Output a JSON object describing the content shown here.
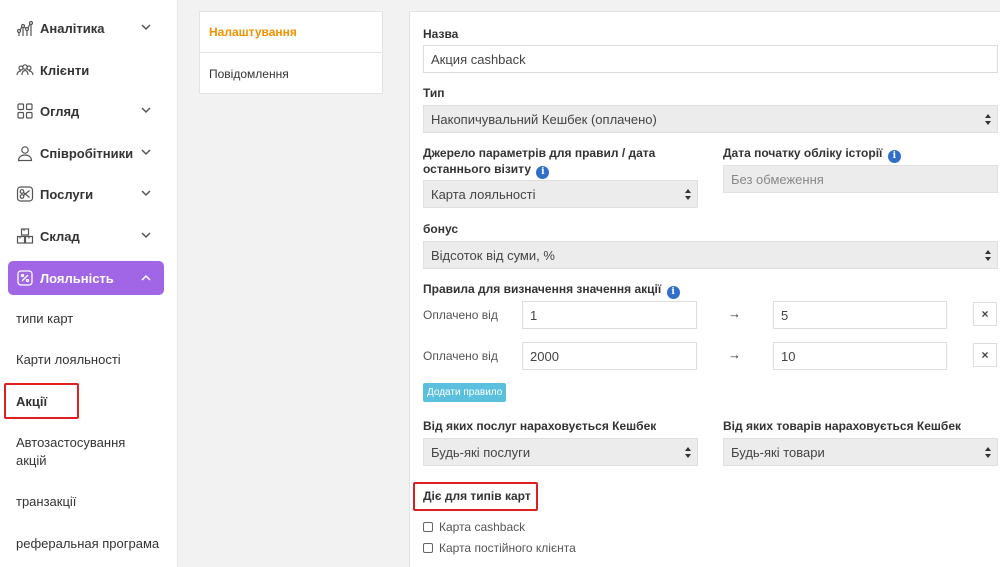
{
  "sidebar": {
    "items": [
      {
        "label": "Аналітика",
        "icon": "analytics-icon"
      },
      {
        "label": "Клієнти",
        "icon": "clients-icon"
      },
      {
        "label": "Огляд",
        "icon": "overview-icon"
      },
      {
        "label": "Співробітники",
        "icon": "person-icon"
      },
      {
        "label": "Послуги",
        "icon": "scissors-icon"
      },
      {
        "label": "Склад",
        "icon": "warehouse-icon"
      },
      {
        "label": "Лояльність",
        "icon": "percent-icon"
      }
    ],
    "subitems": [
      {
        "label": "типи карт"
      },
      {
        "label": "Карти лояльності"
      },
      {
        "label": "Акції"
      },
      {
        "label": "Автозастосування акцій"
      },
      {
        "label": "транзакції"
      },
      {
        "label": "реферальная програма"
      }
    ],
    "active_color": "#a166e6"
  },
  "tabs": [
    {
      "label": "Налаштування"
    },
    {
      "label": "Повідомлення"
    }
  ],
  "form": {
    "name_label": "Назва",
    "name_value": "Акция cashback",
    "type_label": "Тип",
    "type_value": "Накопичувальний Кешбек (оплачено)",
    "source_label": "Джерело параметрів для правил / дата останнього візиту",
    "source_value": "Карта лояльності",
    "history_label": "Дата початку обліку історії",
    "history_placeholder": "Без обмеження",
    "bonus_label": "бонус",
    "bonus_value": "Відсоток від суми, %",
    "rules_label": "Правила для визначення значення акції",
    "rules": [
      {
        "label": "Оплачено від",
        "from": "1",
        "value": "5"
      },
      {
        "label": "Оплачено від",
        "from": "2000",
        "value": "10"
      }
    ],
    "arrow": "→",
    "remove": "×",
    "add_rule": "Додати правило",
    "services_label": "Від яких послуг нараховується Кешбек",
    "services_value": "Будь-які послуги",
    "goods_label": "Від яких товарів нараховується Кешбек",
    "goods_value": "Будь-які товари",
    "card_types_label": "Діє для типів карт",
    "card_types": [
      {
        "label": "Карта cashback",
        "checked": false
      },
      {
        "label": "Карта постійного клієнта",
        "checked": false
      }
    ],
    "info_glyph": "i"
  }
}
